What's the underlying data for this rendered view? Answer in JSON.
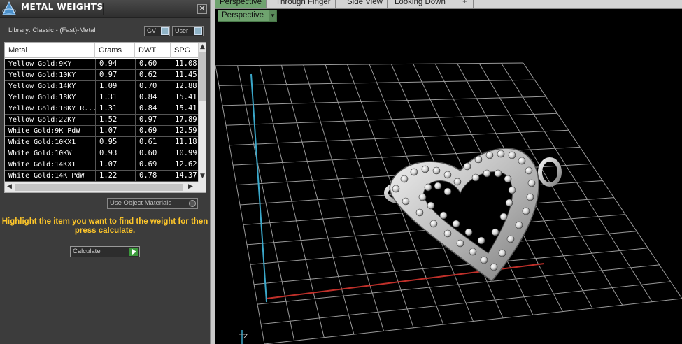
{
  "panel": {
    "title": "METAL WEIGHTS",
    "close": "✕",
    "library_label": "Library: Classic - (Fast)-Metal",
    "toggle_gv": "GV",
    "toggle_user": "User"
  },
  "table": {
    "columns": [
      "Metal",
      "Grams",
      "DWT",
      "SPG"
    ],
    "rows": [
      [
        "Yellow Gold:9KY",
        "0.94",
        "0.60",
        "11.08"
      ],
      [
        "Yellow Gold:10KY",
        "0.97",
        "0.62",
        "11.45"
      ],
      [
        "Yellow Gold:14KY",
        "1.09",
        "0.70",
        "12.88"
      ],
      [
        "Yellow Gold:18KY",
        "1.31",
        "0.84",
        "15.41"
      ],
      [
        "Yellow Gold:18KY R...",
        "1.31",
        "0.84",
        "15.41"
      ],
      [
        "Yellow Gold:22KY",
        "1.52",
        "0.97",
        "17.89"
      ],
      [
        "White Gold:9K PdW",
        "1.07",
        "0.69",
        "12.59"
      ],
      [
        "White Gold:10KX1",
        "0.95",
        "0.61",
        "11.18"
      ],
      [
        "White Gold:10KW",
        "0.93",
        "0.60",
        "10.99"
      ],
      [
        "White Gold:14KX1",
        "1.07",
        "0.69",
        "12.62"
      ],
      [
        "White Gold:14K PdW",
        "1.22",
        "0.78",
        "14.37"
      ]
    ]
  },
  "use_object_materials": "Use Object Materials",
  "hint": "Highlight the item you want to find the weight for then press calculate.",
  "calculate_label": "Calculate",
  "tabs": [
    "Perspective",
    "Through Finger",
    "Side View",
    "Looking Down"
  ],
  "tab_add": "+",
  "view_dropdown": "Perspective",
  "axis_label": "Z",
  "colors": {
    "accent_green": "#6fa36f",
    "hint_yellow": "#ffc72a",
    "x_axis": "#c0302a",
    "z_axis": "#3aa7c9"
  }
}
